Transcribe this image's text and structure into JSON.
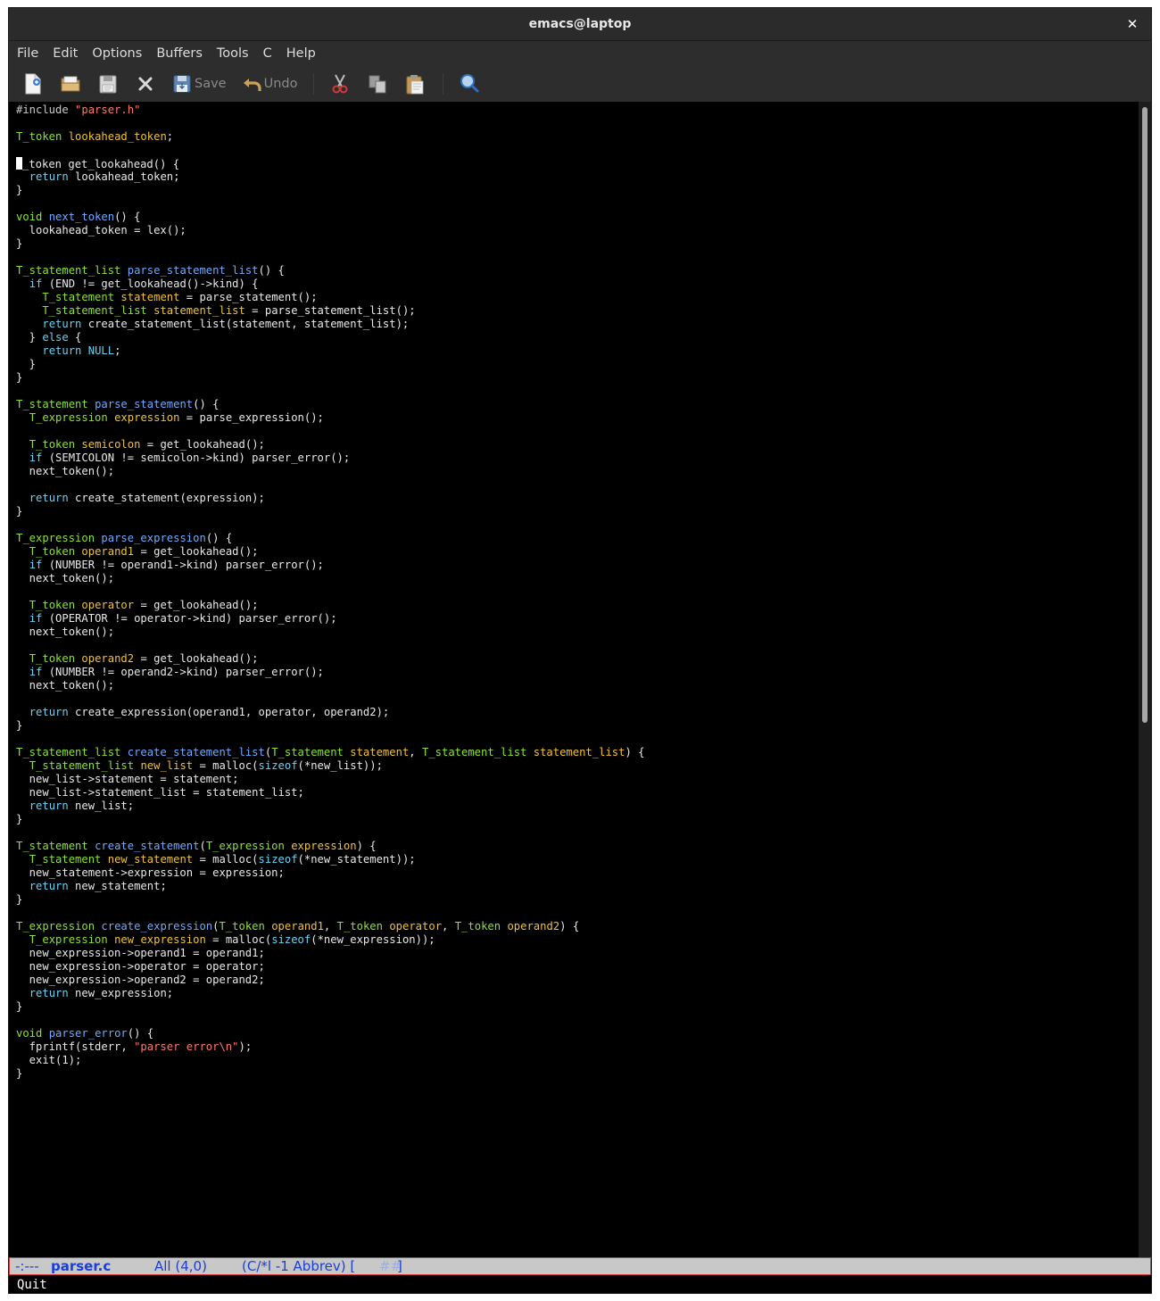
{
  "window": {
    "title": "emacs@laptop",
    "close_glyph": "✕"
  },
  "menubar": {
    "items": [
      "File",
      "Edit",
      "Options",
      "Buffers",
      "Tools",
      "C",
      "Help"
    ]
  },
  "toolbar": {
    "buttons": [
      {
        "name": "new-file",
        "icon": "new-file-icon",
        "label": ""
      },
      {
        "name": "open-file",
        "icon": "folder-icon",
        "label": ""
      },
      {
        "name": "save-file",
        "icon": "floppy-icon",
        "label": ""
      },
      {
        "name": "close-buffer",
        "icon": "close-icon",
        "label": ""
      },
      {
        "name": "save",
        "icon": "save-icon",
        "label": "Save"
      },
      {
        "name": "undo",
        "icon": "undo-arrow-icon",
        "label": "Undo"
      },
      {
        "name": "cut",
        "icon": "scissors-icon",
        "label": ""
      },
      {
        "name": "copy",
        "icon": "copy-icon",
        "label": ""
      },
      {
        "name": "paste",
        "icon": "clipboard-icon",
        "label": ""
      },
      {
        "name": "search",
        "icon": "magnifier-icon",
        "label": ""
      }
    ]
  },
  "editor": {
    "lines": [
      "#include \"parser.h\"",
      "",
      "T_token lookahead_token;",
      "",
      "T_token get_lookahead() {",
      "  return lookahead_token;",
      "}",
      "",
      "void next_token() {",
      "  lookahead_token = lex();",
      "}",
      "",
      "T_statement_list parse_statement_list() {",
      "  if (END != get_lookahead()->kind) {",
      "    T_statement statement = parse_statement();",
      "    T_statement_list statement_list = parse_statement_list();",
      "    return create_statement_list(statement, statement_list);",
      "  } else {",
      "    return NULL;",
      "  }",
      "}",
      "",
      "T_statement parse_statement() {",
      "  T_expression expression = parse_expression();",
      "",
      "  T_token semicolon = get_lookahead();",
      "  if (SEMICOLON != semicolon->kind) parser_error();",
      "  next_token();",
      "",
      "  return create_statement(expression);",
      "}",
      "",
      "T_expression parse_expression() {",
      "  T_token operand1 = get_lookahead();",
      "  if (NUMBER != operand1->kind) parser_error();",
      "  next_token();",
      "",
      "  T_token operator = get_lookahead();",
      "  if (OPERATOR != operator->kind) parser_error();",
      "  next_token();",
      "",
      "  T_token operand2 = get_lookahead();",
      "  if (NUMBER != operand2->kind) parser_error();",
      "  next_token();",
      "",
      "  return create_expression(operand1, operator, operand2);",
      "}",
      "",
      "T_statement_list create_statement_list(T_statement statement, T_statement_list statement_list) {",
      "  T_statement_list new_list = malloc(sizeof(*new_list));",
      "  new_list->statement = statement;",
      "  new_list->statement_list = statement_list;",
      "  return new_list;",
      "}",
      "",
      "T_statement create_statement(T_expression expression) {",
      "  T_statement new_statement = malloc(sizeof(*new_statement));",
      "  new_statement->expression = expression;",
      "  return new_statement;",
      "}",
      "",
      "T_expression create_expression(T_token operand1, T_token operator, T_token operand2) {",
      "  T_expression new_expression = malloc(sizeof(*new_expression));",
      "  new_expression->operand1 = operand1;",
      "  new_expression->operator = operator;",
      "  new_expression->operand2 = operand2;",
      "  return new_expression;",
      "}",
      "",
      "void parser_error() {",
      "  fprintf(stderr, \"parser error\\n\");",
      "  exit(1);",
      "}"
    ],
    "cursor_line": 4,
    "cursor_col": 0,
    "colors": {
      "type": "#8ae234",
      "keyword": "#67d2f3",
      "function": "#6fa9ff",
      "variable": "#f1c233",
      "string": "#f67c6b"
    }
  },
  "modeline": {
    "status": "-:---",
    "buffer_name": "parser.c",
    "position": "All (4,0)",
    "modes": "(C/*l -1 Abbrev) [",
    "faded": "##",
    "close_bracket": "]"
  },
  "echo_area": {
    "message": "Quit"
  }
}
